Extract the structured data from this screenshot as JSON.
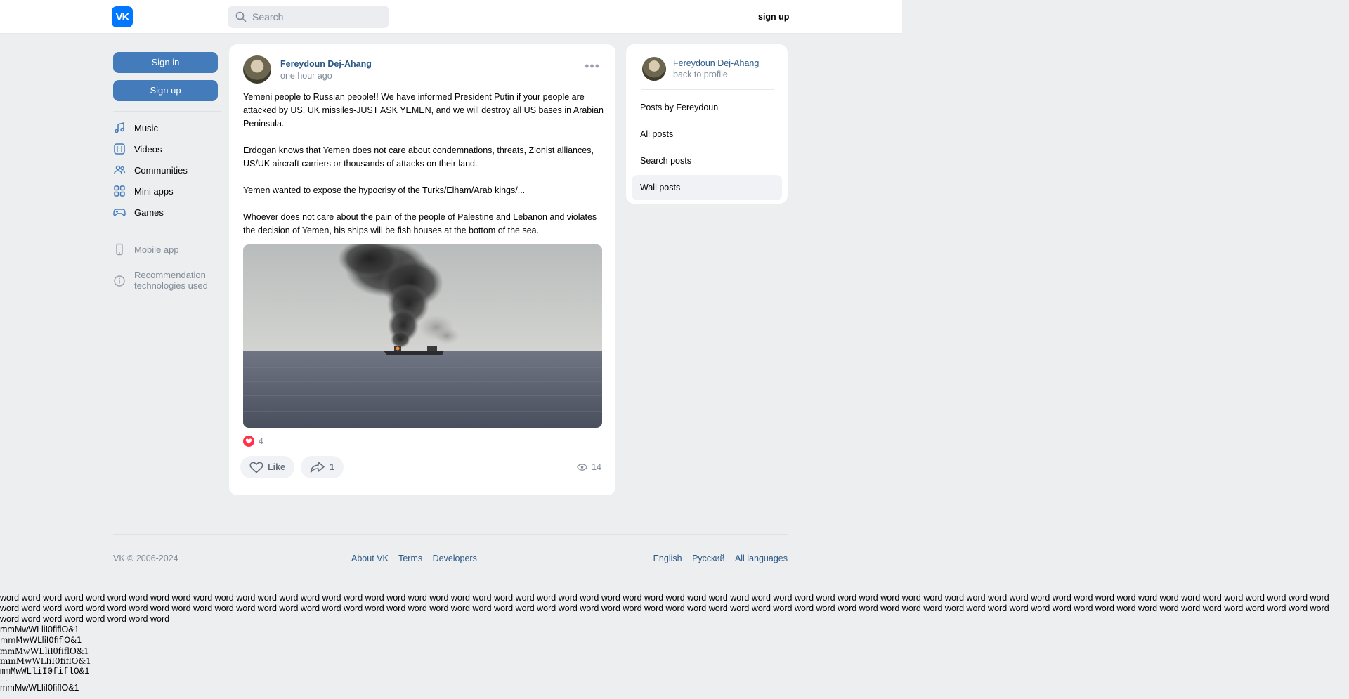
{
  "header": {
    "logo_text": "VK",
    "search_placeholder": "Search",
    "signup_label": "sign up"
  },
  "leftnav": {
    "signin_label": "Sign in",
    "signup_label": "Sign up",
    "items": [
      {
        "label": "Music",
        "icon": "music-icon"
      },
      {
        "label": "Videos",
        "icon": "videos-icon"
      },
      {
        "label": "Communities",
        "icon": "communities-icon"
      },
      {
        "label": "Mini apps",
        "icon": "mini-apps-icon"
      },
      {
        "label": "Games",
        "icon": "games-icon"
      }
    ],
    "secondary": [
      {
        "label": "Mobile app",
        "icon": "mobile-icon"
      },
      {
        "label": "Recommendation technologies used",
        "icon": "info-icon"
      }
    ]
  },
  "post": {
    "author": "Fereydoun Dej-Ahang",
    "time": "one hour ago",
    "paragraphs": [
      "Yemeni people to Russian people!! We have informed President Putin if your people are attacked by US, UK missiles-JUST ASK YEMEN, and we will destroy all US bases in Arabian Peninsula.",
      "Erdogan knows that Yemen does not care about condemnations, threats, Zionist alliances, US/UK aircraft carriers or thousands of attacks on their land.",
      "Yemen wanted to expose the hypocrisy of the Turks/Elham/Arab kings/...",
      "Whoever does not care about the pain of the people of Palestine and Lebanon and violates the decision of Yemen, his ships will be fish houses at the bottom of the sea."
    ],
    "reactions_count": "4",
    "like_label": "Like",
    "share_count": "1",
    "views_count": "14"
  },
  "side": {
    "name": "Fereydoun Dej-Ahang",
    "back_label": "back to profile",
    "menu": [
      {
        "label": "Posts by Fereydoun",
        "active": false
      },
      {
        "label": "All posts",
        "active": false
      },
      {
        "label": "Search posts",
        "active": false
      },
      {
        "label": "Wall posts",
        "active": true
      }
    ]
  },
  "footer": {
    "copyright": "VK © 2006-2024",
    "links": [
      "About VK",
      "Terms",
      "Developers"
    ],
    "languages": [
      "English",
      "Русский",
      "All languages"
    ]
  },
  "debug": {
    "words": "word word word word word word word word word word word word word word word word word word word word word word word word word word word word word word word word word word word word word word word word word word word word word word word word word word word word word word word word word word word word word word word word word word word word word word word word word word word word word word word word word word word word word word word word word word word word word word word word word word word word word word word word word word word word word word word word word word word word word word word word word word word word word word word word word word word word",
    "glyph_lines": [
      "mmMwWLliI0fiflO&1",
      "mmMwWLliI0fiflO&1",
      "mmMwWLliI0fiflO&1",
      "mmMwWLliI0fiflO&1",
      "mmMwWLliI0fiflO&1",
      "...",
      "mmMwWLliI0fiflO&1"
    ]
  },
  "colors": {
    "accent": "#447bba",
    "link": "#2a5885",
    "background": "#edeef0",
    "like_red": "#ff3347"
  }
}
